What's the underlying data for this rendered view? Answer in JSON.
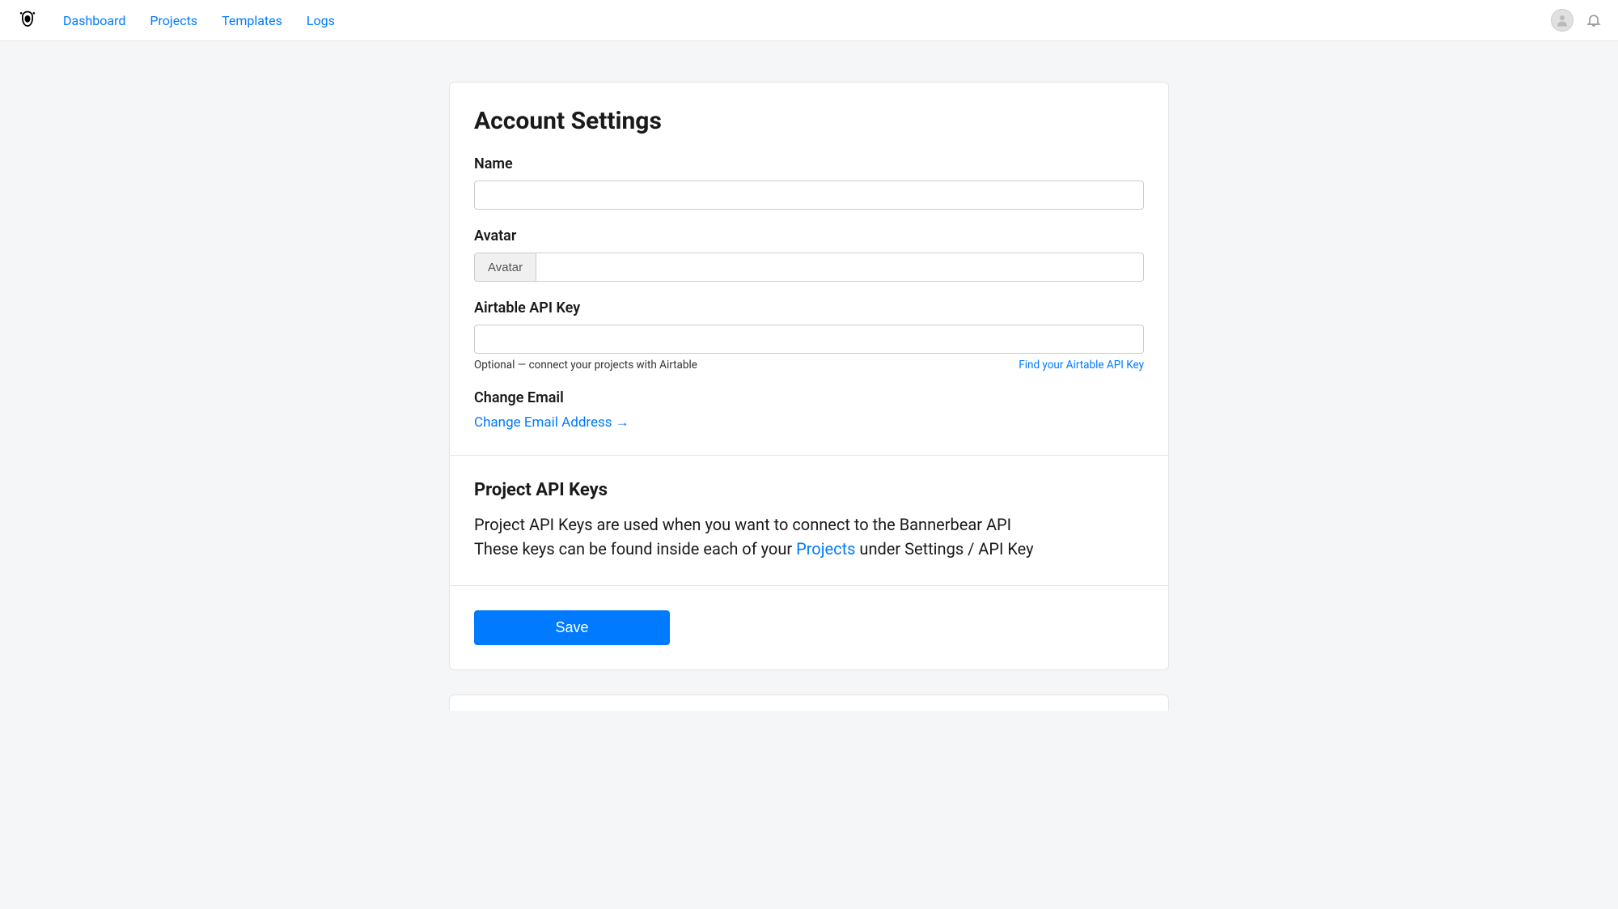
{
  "nav": {
    "links": [
      "Dashboard",
      "Projects",
      "Templates",
      "Logs"
    ]
  },
  "settings": {
    "title": "Account Settings",
    "name_label": "Name",
    "name_value": "",
    "avatar_label": "Avatar",
    "avatar_button": "Avatar",
    "airtable_label": "Airtable API Key",
    "airtable_value": "",
    "airtable_help": "Optional — connect your projects with Airtable",
    "airtable_link": "Find your Airtable API Key",
    "change_email_label": "Change Email",
    "change_email_link": "Change Email Address →"
  },
  "apikeys": {
    "title": "Project API Keys",
    "line1": "Project API Keys are used when you want to connect to the Bannerbear API",
    "line2_a": "These keys can be found inside each of your ",
    "line2_link": "Projects",
    "line2_b": " under Settings / API Key"
  },
  "save_label": "Save"
}
